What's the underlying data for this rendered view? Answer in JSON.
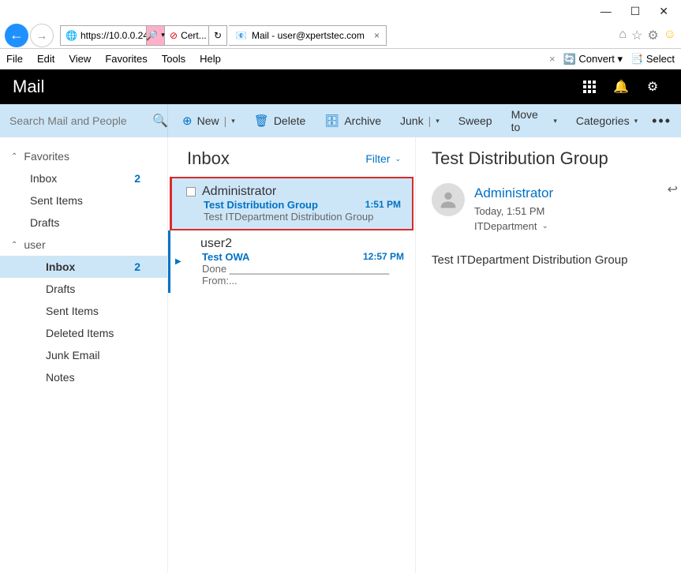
{
  "window": {
    "min": "—",
    "max": "☐",
    "close": "✕"
  },
  "browser": {
    "url": "https://10.0.0.24/",
    "search_glyph": "🔎",
    "cert_label": "Cert...",
    "tab_title": "Mail - user@xpertstec.com"
  },
  "menubar": {
    "items": [
      "File",
      "Edit",
      "View",
      "Favorites",
      "Tools",
      "Help"
    ],
    "convert": "Convert",
    "select": "Select"
  },
  "app": {
    "title": "Mail"
  },
  "search": {
    "placeholder": "Search Mail and People"
  },
  "toolbar": {
    "new": "New",
    "delete": "Delete",
    "archive": "Archive",
    "junk": "Junk",
    "sweep": "Sweep",
    "move": "Move to",
    "categories": "Categories"
  },
  "sidebar": {
    "groups": [
      {
        "label": "Favorites",
        "items": [
          {
            "label": "Inbox",
            "count": "2"
          },
          {
            "label": "Sent Items"
          },
          {
            "label": "Drafts"
          }
        ]
      },
      {
        "label": "user",
        "items": [
          {
            "label": "Inbox",
            "count": "2",
            "active": true
          },
          {
            "label": "Drafts"
          },
          {
            "label": "Sent Items"
          },
          {
            "label": "Deleted Items"
          },
          {
            "label": "Junk Email"
          },
          {
            "label": "Notes"
          }
        ]
      }
    ]
  },
  "list": {
    "title": "Inbox",
    "filter": "Filter",
    "messages": [
      {
        "from": "Administrator",
        "subject": "Test Distribution Group",
        "time": "1:51 PM",
        "preview": "Test ITDepartment Distribution Group",
        "selected": true,
        "unread": true
      },
      {
        "from": "user2",
        "subject": "Test OWA",
        "time": "12:57 PM",
        "preview": "Done ____________________________ From:...",
        "unread": true,
        "arrow": true
      }
    ]
  },
  "reading": {
    "subject": "Test Distribution Group",
    "sender": "Administrator",
    "datetime": "Today, 1:51 PM",
    "to": "ITDepartment",
    "body": "Test ITDepartment Distribution Group"
  }
}
